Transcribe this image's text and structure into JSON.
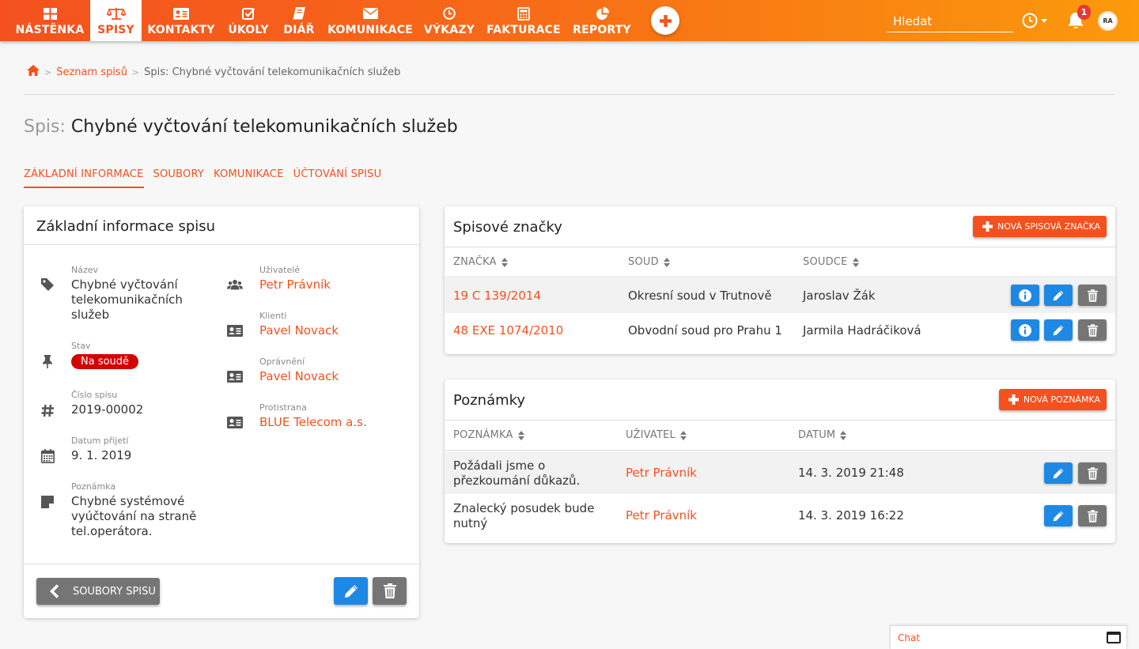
{
  "nav": {
    "items": [
      {
        "label": "NÁSTĚNKA",
        "icon": "dashboard-icon"
      },
      {
        "label": "SPISY",
        "icon": "scales-icon"
      },
      {
        "label": "KONTAKTY",
        "icon": "contact-card-icon"
      },
      {
        "label": "ÚKOLY",
        "icon": "checkbox-icon"
      },
      {
        "label": "DIÁŘ",
        "icon": "book-icon"
      },
      {
        "label": "KOMUNIKACE",
        "icon": "envelope-icon"
      },
      {
        "label": "VÝKAZY",
        "icon": "clock-icon"
      },
      {
        "label": "FAKTURACE",
        "icon": "calculator-icon"
      },
      {
        "label": "REPORTY",
        "icon": "pie-chart-icon"
      }
    ],
    "active": "SPISY",
    "search_placeholder": "Hledat",
    "notification_count": "1",
    "avatar_initials": "RA"
  },
  "breadcrumb": {
    "link": "Seznam spisů",
    "current": "Spis: Chybné vyčtování telekomunikačních služeb"
  },
  "title": {
    "prefix": "Spis:",
    "name": "Chybné vyčtování telekomunikačních služeb"
  },
  "tabs": [
    "ZÁKLADNÍ INFORMACE",
    "SOUBORY",
    "KOMUNIKACE",
    "ÚČTOVÁNÍ SPISU"
  ],
  "info": {
    "title": "Základní informace spisu",
    "name_label": "Název",
    "name_lines": [
      "Chybné vyčtování",
      "telekomunikačních",
      "služeb"
    ],
    "status_label": "Stav",
    "status_value": "Na soudě",
    "number_label": "Číslo spisu",
    "number_value": "2019-00002",
    "date_label": "Datum přijetí",
    "date_value": "9. 1. 2019",
    "note_label": "Poznámka",
    "note_lines": [
      "Chybné systémové",
      "vyúčtování na straně",
      "tel.operátora."
    ],
    "users_label": "Uživatelé",
    "users_value": "Petr Právník",
    "clients_label": "Klienti",
    "clients_value": "Pavel Novack",
    "authorized_label": "Oprávnění",
    "authorized_value": "Pavel Novack",
    "opponent_label": "Protistrana",
    "opponent_value": "BLUE Telecom a.s.",
    "files_button": "SOUBORY SPISU"
  },
  "marks": {
    "title": "Spisové značky",
    "new_button": "NOVÁ SPISOVÁ ZNAČKA",
    "headers": [
      "ZNAČKA",
      "SOUD",
      "SOUDCE"
    ],
    "rows": [
      {
        "mark": "19 C 139/2014",
        "court": "Okresní soud v Trutnově",
        "judge": "Jaroslav Žák"
      },
      {
        "mark": "48 EXE 1074/2010",
        "court": "Obvodní soud pro Prahu 1",
        "judge": "Jarmila Hadráčiková"
      }
    ]
  },
  "notes": {
    "title": "Poznámky",
    "new_button": "NOVÁ POZNÁMKA",
    "headers": [
      "POZNÁMKA",
      "UŽIVATEL",
      "DATUM"
    ],
    "rows": [
      {
        "lines": [
          "Požádali jsme o",
          "přezkoumání důkazů."
        ],
        "user": "Petr Právník",
        "date": "14. 3. 2019 21:48"
      },
      {
        "lines": [
          "Znalecký posudek bude",
          "nutný"
        ],
        "user": "Petr Právník",
        "date": "14. 3. 2019 16:22"
      }
    ]
  },
  "chat": {
    "label": "Chat"
  },
  "colors": {
    "accent": "#f4511e",
    "accent_end": "#fb9a0b",
    "blue": "#1e88e5",
    "gray": "#757575",
    "status_red": "#d50000"
  }
}
